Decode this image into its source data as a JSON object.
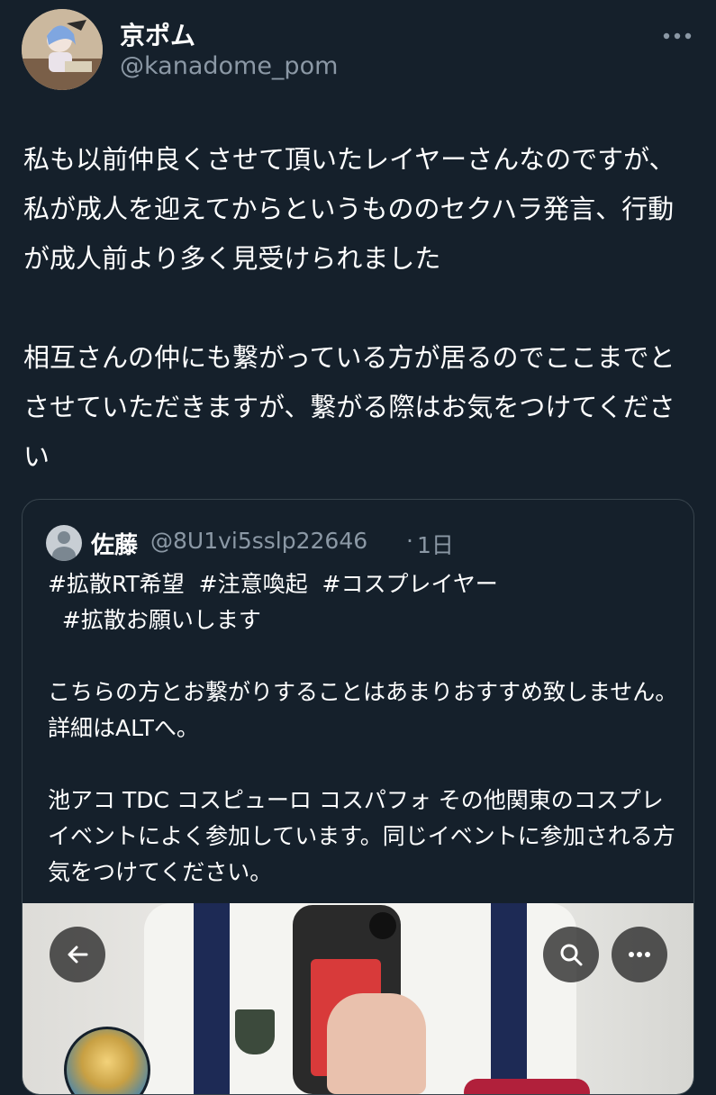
{
  "user": {
    "display_name": "京ポム",
    "handle": "@kanadome_pom",
    "more_icon": "more-horizontal-icon"
  },
  "tweet": {
    "text": "私も以前仲良くさせて頂いたレイヤーさんなのですが、私が成人を迎えてからというもののセクハラ発言、行動が成人前より多く見受けられました\n\n相互さんの仲にも繋がっている方が居るのでここまでとさせていただきますが、繋がる際はお気をつけてください"
  },
  "quoted_tweet": {
    "display_name": "佐藤",
    "handle": "@8U1vi5sslp22646",
    "separator": "·",
    "time": "1日",
    "text": "#拡散RT希望  #注意喚起  #コスプレイヤー\n  #拡散お願いします\n\nこちらの方とお繋がりすることはあまりおすすめ致しません。詳細はALTへ。\n\n池アコ TDC コスピューロ コスパフォ その他関東のコスプレイベントによく参加しています。同じイベントに参加される方気をつけてください。",
    "media_buttons": {
      "back": "back-arrow-icon",
      "search": "search-icon",
      "more": "more-horizontal-icon"
    }
  },
  "colors": {
    "background": "#15202b",
    "text": "#ffffff",
    "secondary": "#8b98a5",
    "border": "#38444d"
  }
}
